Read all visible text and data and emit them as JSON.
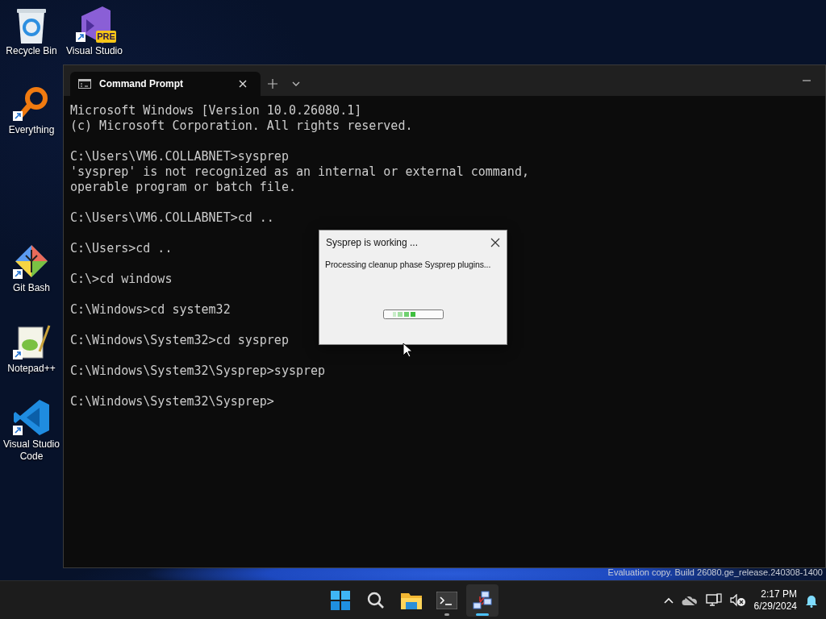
{
  "desktop_icons": [
    {
      "label": "Recycle Bin",
      "kind": "recycle-bin",
      "shortcut": false
    },
    {
      "label": "Visual Studio",
      "kind": "visual-studio",
      "shortcut": true,
      "badge": "PRE"
    },
    {
      "label": "Everything",
      "kind": "everything",
      "shortcut": true
    },
    {
      "label": "Git Bash",
      "kind": "git",
      "shortcut": true
    },
    {
      "label": "Notepad++",
      "kind": "notepad",
      "shortcut": true
    },
    {
      "label": "Visual Studio Code",
      "kind": "vscode",
      "shortcut": true
    }
  ],
  "terminal": {
    "tabs": [
      {
        "title": "Command Prompt",
        "selected": true
      }
    ],
    "blocks": [
      [
        "Microsoft Windows [Version 10.0.26080.1]",
        "(c) Microsoft Corporation. All rights reserved."
      ],
      [
        "C:\\Users\\VM6.COLLABNET>sysprep",
        "'sysprep' is not recognized as an internal or external command,",
        "operable program or batch file."
      ],
      [
        "C:\\Users\\VM6.COLLABNET>cd .."
      ],
      [
        "C:\\Users>cd .."
      ],
      [
        "C:\\>cd windows"
      ],
      [
        "C:\\Windows>cd system32"
      ],
      [
        "C:\\Windows\\System32>cd sysprep"
      ],
      [
        "C:\\Windows\\System32\\Sysprep>sysprep"
      ],
      [
        "C:\\Windows\\System32\\Sysprep>"
      ]
    ]
  },
  "dialog": {
    "title": "Sysprep is working ...",
    "message": "Processing cleanup phase Sysprep plugins...",
    "progress": {
      "indeterminate": true
    }
  },
  "build_info": "Evaluation copy. Build 26080.ge_release.240308-1400",
  "taskbar": {
    "apps": [
      {
        "kind": "start",
        "running": false,
        "selected": false
      },
      {
        "kind": "search",
        "running": false,
        "selected": false
      },
      {
        "kind": "explorer",
        "running": false,
        "selected": false
      },
      {
        "kind": "terminal",
        "running": true,
        "selected": false
      },
      {
        "kind": "network-app",
        "running": true,
        "selected": true
      }
    ],
    "time": "2:17 PM",
    "date": "6/29/2024"
  }
}
